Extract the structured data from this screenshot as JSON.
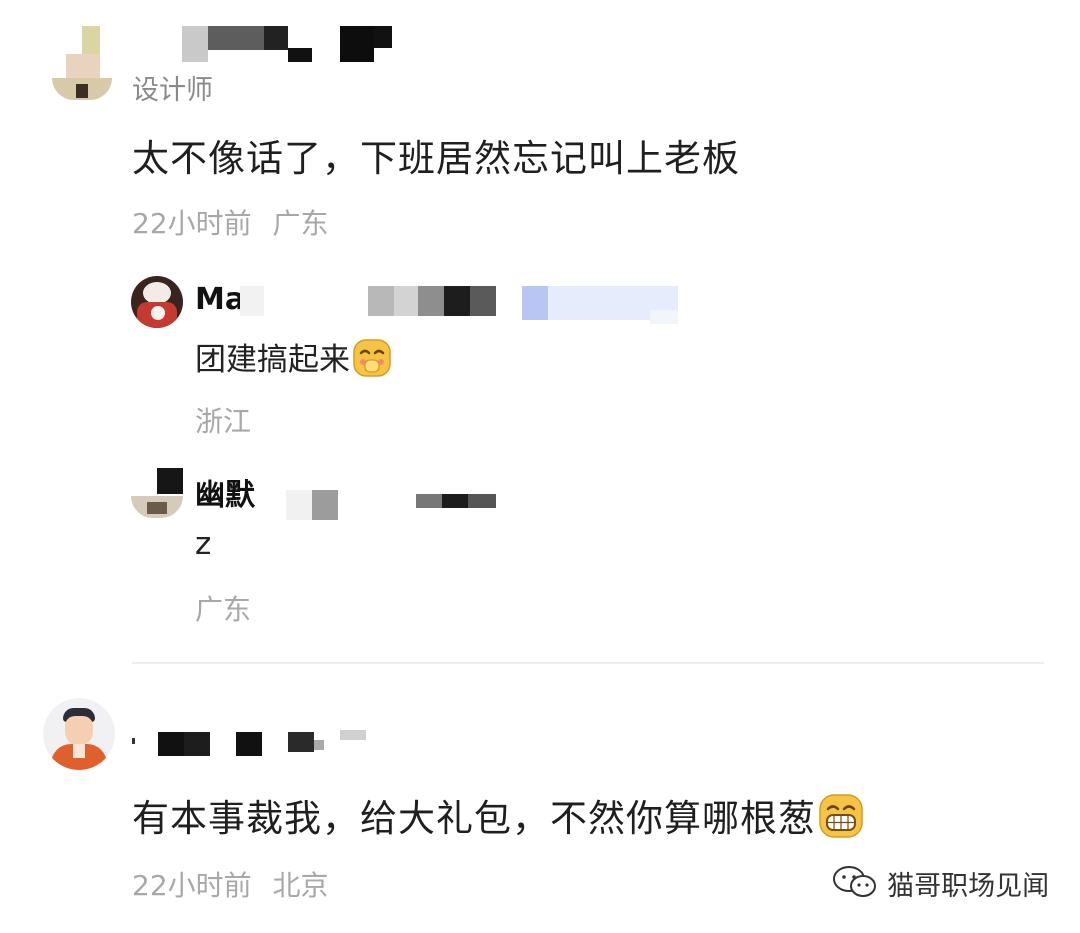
{
  "comments": [
    {
      "tag": "设计师",
      "text": "太不像话了，下班居然忘记叫上老板",
      "time": "22小时前",
      "location": "广东",
      "replies": [
        {
          "name": "Ma",
          "text": "团建搞起来",
          "emoji": "smirk-hand-face-icon",
          "location": "浙江"
        },
        {
          "name": "幽默",
          "text": "z",
          "location": "广东"
        }
      ]
    },
    {
      "text": "有本事裁我，给大礼包，不然你算哪根葱",
      "emoji": "grinning-face-icon",
      "time": "22小时前",
      "location": "北京"
    }
  ],
  "watermark": {
    "icon": "wechat-icon",
    "text": "猫哥职场见闻"
  },
  "colors": {
    "meta_gray": "#a8a8a8",
    "emoji_yellow": "#f6c444",
    "avatar_orange": "#e0602d"
  }
}
